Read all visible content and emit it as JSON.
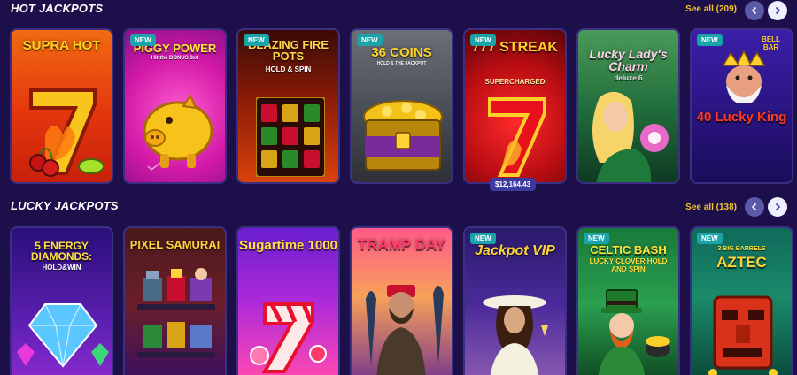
{
  "hot": {
    "title": "HOT JACKPOTS",
    "see_all": "See all",
    "count": "(209)",
    "games": [
      {
        "title": "SUPRA HOT",
        "new": false
      },
      {
        "title": "PIGGY POWER",
        "subtitle": "Hit the BONUS 3x3",
        "new": true
      },
      {
        "title": "BLAZING FIRE POTS",
        "subtitle": "HOLD & SPIN",
        "new": true
      },
      {
        "title": "36 COINS",
        "subtitle": "HOLD & THE JACKPOT",
        "new": true
      },
      {
        "title": "777 STREAK",
        "subtitle": "SUPERCHARGED",
        "new": true,
        "jackpot": "$12,164.43"
      },
      {
        "title": "Lucky Lady's Charm",
        "subtitle": "deluxe 6",
        "new": false
      },
      {
        "title": "40 Lucky King",
        "subtitle": "BELL BAR",
        "new": true
      }
    ]
  },
  "lucky": {
    "title": "LUCKY JACKPOTS",
    "see_all": "See all",
    "count": "(138)",
    "games": [
      {
        "title": "5 ENERGY DIAMONDS:",
        "subtitle": "HOLD&WIN",
        "new": false
      },
      {
        "title": "PIXEL SAMURAI",
        "new": false
      },
      {
        "title": "Sugartime 1000",
        "new": false
      },
      {
        "title": "TRAMP DAY",
        "new": false
      },
      {
        "title": "Jackpot VIP",
        "new": true
      },
      {
        "title": "CELTIC BASH",
        "subtitle": "LUCKY CLOVER HOLD AND SPIN",
        "new": true
      },
      {
        "title": "AZTEC",
        "subtitle": "3 BIG BARRELS",
        "new": true
      }
    ]
  },
  "labels": {
    "new_badge": "NEW"
  },
  "icons": {
    "prev": "chevron-left-icon",
    "next": "chevron-right-icon"
  },
  "colors": {
    "background": "#1c0f4a",
    "accent": "#f2c230",
    "badge": "#1aa3a8"
  }
}
